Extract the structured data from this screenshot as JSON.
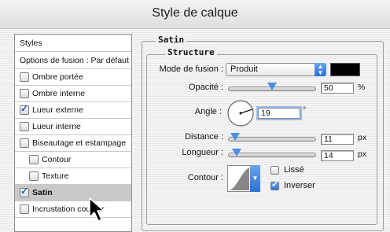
{
  "window": {
    "title": "Style de calque"
  },
  "sidebar": {
    "header": "Styles",
    "options": "Options de fusion : Par défaut",
    "items": [
      {
        "label": "Ombre portée",
        "checked": false,
        "indent": false
      },
      {
        "label": "Ombre interne",
        "checked": false,
        "indent": false
      },
      {
        "label": "Lueur externe",
        "checked": true,
        "indent": false
      },
      {
        "label": "Lueur interne",
        "checked": false,
        "indent": false
      },
      {
        "label": "Biseautage et estampage",
        "checked": false,
        "indent": false
      },
      {
        "label": "Contour",
        "checked": false,
        "indent": true
      },
      {
        "label": "Texture",
        "checked": false,
        "indent": true
      },
      {
        "label": "Satin",
        "checked": true,
        "indent": false,
        "selected": true
      },
      {
        "label": "Incrustation couleur",
        "checked": false,
        "indent": false
      }
    ]
  },
  "panel": {
    "group_title": "Satin",
    "section_title": "Structure",
    "blend_mode_label": "Mode de fusion :",
    "blend_mode_value": "Produit",
    "color": "#000000",
    "opacity_label": "Opacité :",
    "opacity_value": "50",
    "opacity_unit": "%",
    "angle_label": "Angle :",
    "angle_value": "19",
    "angle_unit": "°",
    "distance_label": "Distance :",
    "distance_value": "11",
    "distance_unit": "px",
    "size_label": "Longueur :",
    "size_value": "14",
    "size_unit": "px",
    "contour_label": "Contour :",
    "antialias_label": "Lissé",
    "antialias_checked": false,
    "invert_label": "Inverser",
    "invert_checked": true
  }
}
